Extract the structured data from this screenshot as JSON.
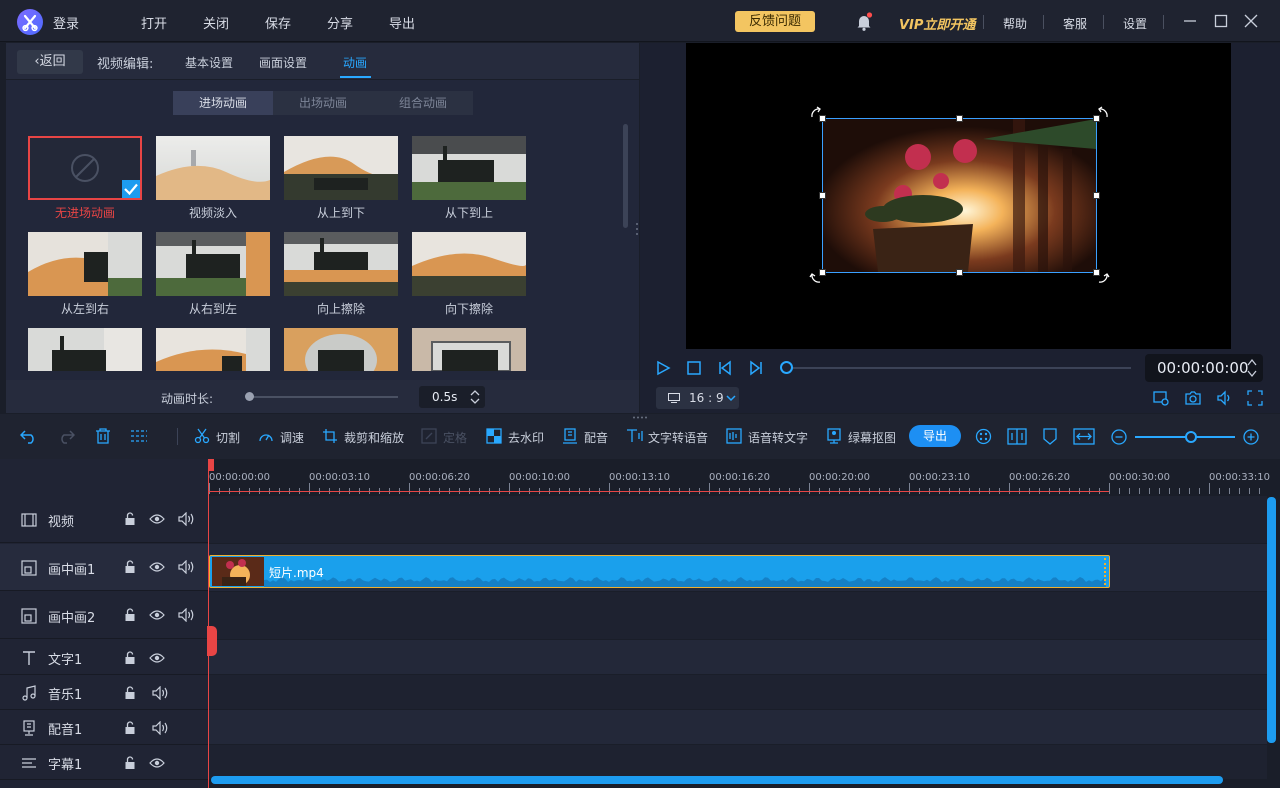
{
  "app": {
    "login_label": "登录",
    "feedback_label": "反馈问题",
    "vip_label": "VIP立即开通"
  },
  "menu": [
    "打开",
    "关闭",
    "保存",
    "分享",
    "导出"
  ],
  "right_menu": [
    "帮助",
    "客服",
    "设置"
  ],
  "editor": {
    "back_label": "返回",
    "section_label": "视频编辑:",
    "tabs": [
      "基本设置",
      "画面设置",
      "动画"
    ],
    "active_tab": "动画",
    "subtabs": [
      "进场动画",
      "出场动画",
      "组合动画"
    ],
    "active_subtab": "进场动画",
    "animations": [
      {
        "label": "无进场动画",
        "selected": true
      },
      {
        "label": "视频淡入"
      },
      {
        "label": "从上到下"
      },
      {
        "label": "从下到上"
      },
      {
        "label": "从左到右"
      },
      {
        "label": "从右到左"
      },
      {
        "label": "向上擦除"
      },
      {
        "label": "向下擦除"
      },
      {
        "label": ""
      },
      {
        "label": ""
      },
      {
        "label": ""
      },
      {
        "label": ""
      }
    ],
    "duration_label": "动画时长:",
    "duration_value": "0.5s"
  },
  "preview": {
    "timecode": "00:00:00:00",
    "aspect_ratio": "16 : 9"
  },
  "toolbar": {
    "cut": "切割",
    "speed": "调速",
    "crop_zoom": "裁剪和缩放",
    "freeze": "定格",
    "watermark": "去水印",
    "dubbing": "配音",
    "tts": "文字转语音",
    "stt": "语音转文字",
    "chroma": "绿幕抠图",
    "export": "导出"
  },
  "timeline": {
    "ruler": [
      "00:00:00:00",
      "00:00:03:10",
      "00:00:06:20",
      "00:00:10:00",
      "00:00:13:10",
      "00:00:16:20",
      "00:00:20:00",
      "00:00:23:10",
      "00:00:26:20",
      "00:00:30:00",
      "00:00:33:10"
    ],
    "tracks": [
      "视频",
      "画中画1",
      "画中画2",
      "文字1",
      "音乐1",
      "配音1",
      "字幕1"
    ],
    "clip_name": "短片.mp4"
  },
  "colors": {
    "accent": "#1d9cf0",
    "selected_border": "#e84545",
    "vip": "#f3c561"
  }
}
